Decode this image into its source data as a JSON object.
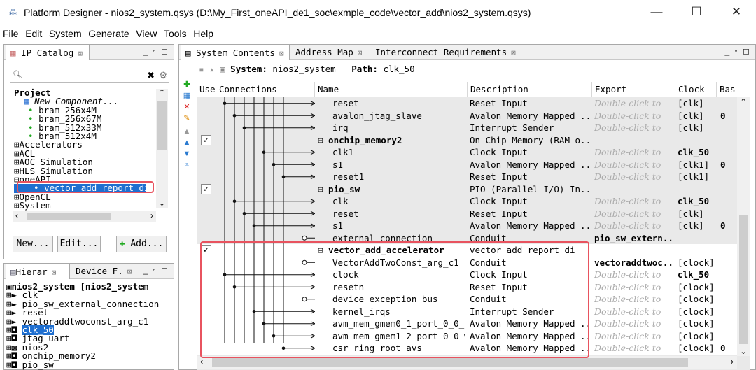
{
  "window": {
    "title": "Platform Designer - nios2_system.qsys (D:\\My_First_oneAPI_de1_soc\\exmple_code\\vector_add\\nios2_system.qsys)",
    "minimize": "—",
    "maximize": "☐",
    "close": "✕"
  },
  "menu": [
    "File",
    "Edit",
    "System",
    "Generate",
    "View",
    "Tools",
    "Help"
  ],
  "ip_catalog": {
    "tab": "IP Catalog",
    "search_placeholder": "",
    "tree": [
      "Project",
      "New Component...",
      "bram_256x4M",
      "bram_256x67M",
      "bram_512x33M",
      "bram_512x4M",
      "Accelerators",
      "ACL",
      "AOC Simulation",
      "HLS Simulation",
      "oneAPI",
      "vector_add_report_di",
      "OpenCL",
      "System"
    ],
    "buttons": {
      "new": "New...",
      "edit": "Edit...",
      "add": "Add..."
    }
  },
  "hierarchy": {
    "tab1": "Hierar",
    "tab2": "Device F.",
    "items": [
      "nios2_system [nios2_system",
      "clk",
      "pio_sw_external_connection",
      "reset",
      "vectoraddtwoconst_arg_c1",
      "clk_50",
      "jtag_uart",
      "nios2",
      "onchip_memory2",
      "pio_sw"
    ]
  },
  "system_contents": {
    "tabs": [
      "System Contents",
      "Address Map",
      "Interconnect Requirements"
    ],
    "system_label": "System:",
    "system_name": "nios2_system",
    "path_label": "Path:",
    "path_value": "clk_50",
    "columns": [
      "Use",
      "Connections",
      "Name",
      "Description",
      "Export",
      "Clock",
      "Bas"
    ],
    "rows": [
      {
        "name": "reset",
        "desc": "Reset Input",
        "export": "Double-click to",
        "clock": "[clk]",
        "base": ""
      },
      {
        "name": "avalon_jtag_slave",
        "desc": "Avalon Memory Mapped ...",
        "export": "Double-click to",
        "clock": "[clk]",
        "base": "0"
      },
      {
        "name": "irq",
        "desc": "Interrupt Sender",
        "export": "Double-click to",
        "clock": "[clk]",
        "base": ""
      },
      {
        "name": "onchip_memory2",
        "desc": "On-Chip Memory (RAM o...",
        "export": "",
        "clock": "",
        "base": "",
        "group": true,
        "checked": true
      },
      {
        "name": "clk1",
        "desc": "Clock Input",
        "export": "Double-click to",
        "clock": "clk_50",
        "base": "",
        "bold": true
      },
      {
        "name": "s1",
        "desc": "Avalon Memory Mapped ...",
        "export": "Double-click to",
        "clock": "[clk1]",
        "base": "0"
      },
      {
        "name": "reset1",
        "desc": "Reset Input",
        "export": "Double-click to",
        "clock": "[clk1]",
        "base": ""
      },
      {
        "name": "pio_sw",
        "desc": "PIO (Parallel I/O) In...",
        "export": "",
        "clock": "",
        "base": "",
        "group": true,
        "checked": true
      },
      {
        "name": "clk",
        "desc": "Clock Input",
        "export": "Double-click to",
        "clock": "clk_50",
        "base": "",
        "bold": true
      },
      {
        "name": "reset",
        "desc": "Reset Input",
        "export": "Double-click to",
        "clock": "[clk]",
        "base": ""
      },
      {
        "name": "s1",
        "desc": "Avalon Memory Mapped ...",
        "export": "Double-click to",
        "clock": "[clk]",
        "base": "0"
      },
      {
        "name": "external_connection",
        "desc": "Conduit",
        "export": "pio_sw_extern...",
        "clock": "",
        "base": "",
        "exportbold": true
      },
      {
        "name": "vector_add_accelerator",
        "desc": "vector_add_report_di",
        "export": "",
        "clock": "",
        "base": "",
        "group": true,
        "checked": true
      },
      {
        "name": "VectorAddTwoConst_arg_c1",
        "desc": "Conduit",
        "export": "vectoraddtwoc...",
        "clock": "[clock]",
        "base": "",
        "exportbold": true
      },
      {
        "name": "clock",
        "desc": "Clock Input",
        "export": "Double-click to",
        "clock": "clk_50",
        "base": "",
        "bold": true
      },
      {
        "name": "resetn",
        "desc": "Reset Input",
        "export": "Double-click to",
        "clock": "[clock]",
        "base": ""
      },
      {
        "name": "device_exception_bus",
        "desc": "Conduit",
        "export": "Double-click to",
        "clock": "[clock]",
        "base": ""
      },
      {
        "name": "kernel_irqs",
        "desc": "Interrupt Sender",
        "export": "Double-click to",
        "clock": "[clock]",
        "base": ""
      },
      {
        "name": "avm_mem_gmem0_1_port_0_0_r",
        "desc": "Avalon Memory Mapped ...",
        "export": "Double-click to",
        "clock": "[clock]",
        "base": ""
      },
      {
        "name": "avm_mem_gmem1_2_port_0_0_w",
        "desc": "Avalon Memory Mapped ...",
        "export": "Double-click to",
        "clock": "[clock]",
        "base": ""
      },
      {
        "name": "csr_ring_root_avs",
        "desc": "Avalon Memory Mapped ...",
        "export": "Double-click to",
        "clock": "[clock]",
        "base": "0"
      }
    ]
  }
}
